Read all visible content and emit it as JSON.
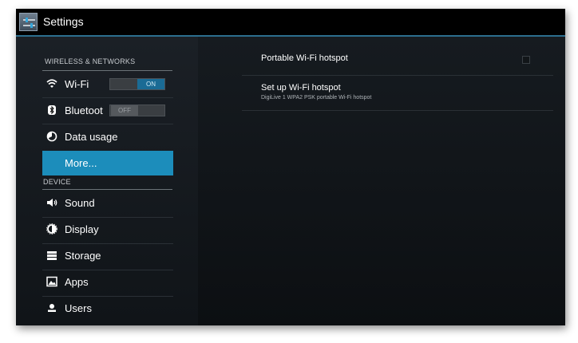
{
  "app": {
    "title": "Settings",
    "icon": "settings-sliders-icon"
  },
  "sidebar": {
    "sections": [
      {
        "header": "WIRELESS & NETWORKS"
      },
      {
        "header": "DEVICE"
      }
    ],
    "items": [
      {
        "label": "Wi-Fi",
        "icon": "wifi-icon",
        "toggle": "ON",
        "toggle_state": "on"
      },
      {
        "label": "Bluetoot",
        "icon": "bluetooth-icon",
        "toggle": "OFF",
        "toggle_state": "off"
      },
      {
        "label": "Data usage",
        "icon": "data-usage-icon"
      },
      {
        "label": "More...",
        "icon": "",
        "selected": true
      },
      {
        "label": "Sound",
        "icon": "sound-icon"
      },
      {
        "label": "Display",
        "icon": "display-icon"
      },
      {
        "label": "Storage",
        "icon": "storage-icon"
      },
      {
        "label": "Apps",
        "icon": "apps-icon"
      },
      {
        "label": "Users",
        "icon": "users-icon"
      }
    ]
  },
  "main": {
    "preferences": [
      {
        "title": "Portable Wi-Fi hotspot",
        "checked": false
      },
      {
        "title": "Set up Wi-Fi hotspot",
        "summary": "DigiLive 1 WPA2 PSK portable Wi-Fi hotspot"
      }
    ]
  },
  "colors": {
    "accent": "#1c8dbb",
    "toggle_on": "#1a6b95",
    "background": "#121619"
  }
}
